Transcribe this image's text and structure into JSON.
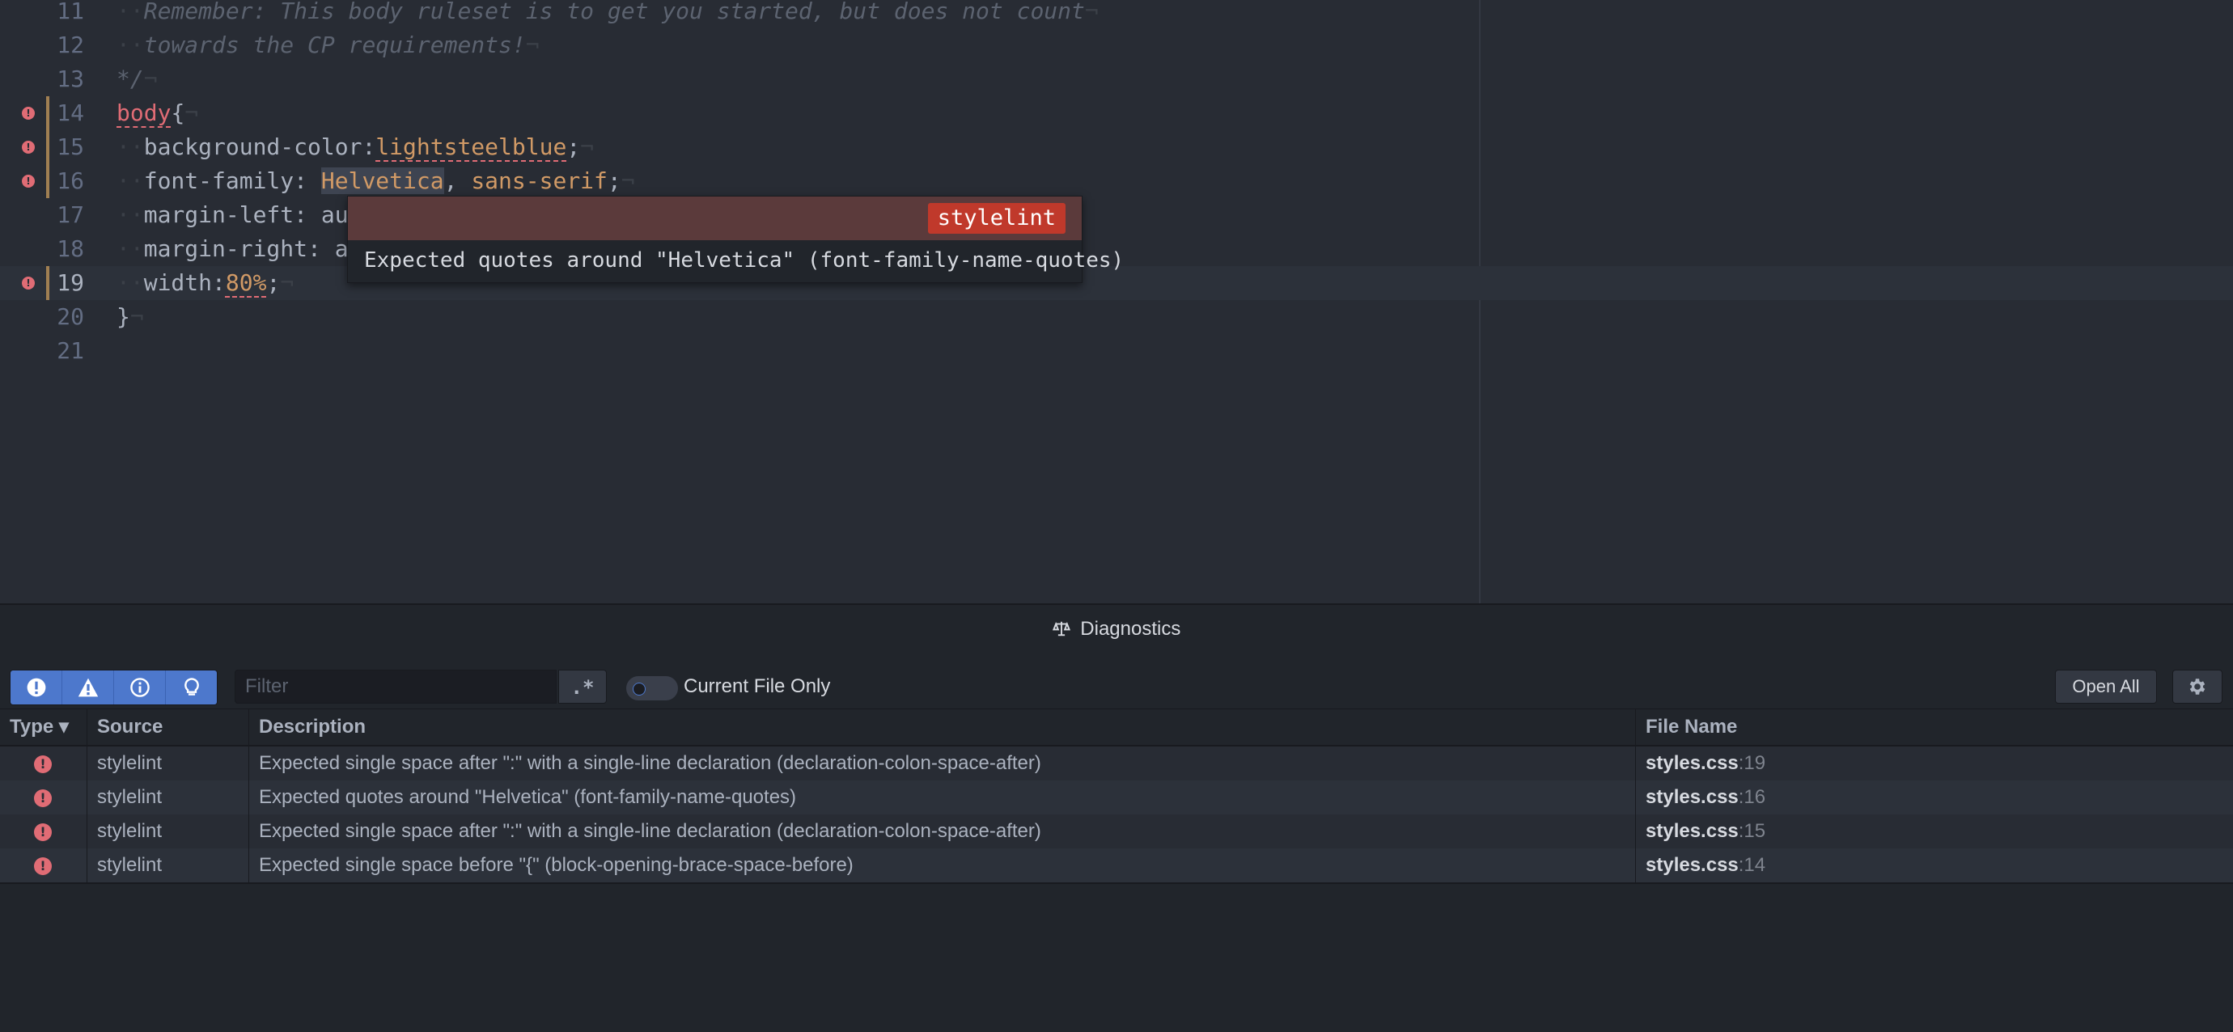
{
  "editor": {
    "lines": [
      {
        "num": "11",
        "segments": [
          {
            "t": "··",
            "c": "inv"
          },
          {
            "t": "Remember: This body ruleset is to get you started, but does not count",
            "c": "comment"
          },
          {
            "t": "¬",
            "c": "inv"
          }
        ]
      },
      {
        "num": "12",
        "segments": [
          {
            "t": "··",
            "c": "inv"
          },
          {
            "t": "towards the CP requirements!",
            "c": "comment"
          },
          {
            "t": "¬",
            "c": "inv"
          }
        ]
      },
      {
        "num": "13",
        "segments": [
          {
            "t": "*/",
            "c": "comment"
          },
          {
            "t": "¬",
            "c": "inv"
          }
        ]
      },
      {
        "num": "14",
        "error": true,
        "git": true,
        "segments": [
          {
            "t": "body",
            "c": "sel squig"
          },
          {
            "t": "{",
            "c": "prop"
          },
          {
            "t": "¬",
            "c": "inv"
          }
        ]
      },
      {
        "num": "15",
        "error": true,
        "git": true,
        "segments": [
          {
            "t": "··",
            "c": "inv"
          },
          {
            "t": "background-color:",
            "c": "prop"
          },
          {
            "t": "lightsteelblue",
            "c": "val squig"
          },
          {
            "t": ";",
            "c": "prop"
          },
          {
            "t": "¬",
            "c": "inv"
          }
        ]
      },
      {
        "num": "16",
        "error": true,
        "git": true,
        "segments": [
          {
            "t": "··",
            "c": "inv"
          },
          {
            "t": "font-family: ",
            "c": "prop"
          },
          {
            "t": "Helvetica",
            "c": "val sel-word"
          },
          {
            "t": ", ",
            "c": "prop"
          },
          {
            "t": "sans-serif",
            "c": "val"
          },
          {
            "t": ";",
            "c": "prop"
          },
          {
            "t": "¬",
            "c": "inv"
          }
        ]
      },
      {
        "num": "17",
        "segments": [
          {
            "t": "··",
            "c": "inv"
          },
          {
            "t": "margin-left: au",
            "c": "prop"
          }
        ]
      },
      {
        "num": "18",
        "segments": [
          {
            "t": "··",
            "c": "inv"
          },
          {
            "t": "margin-right: a",
            "c": "prop"
          }
        ]
      },
      {
        "num": "19",
        "error": true,
        "git": true,
        "cursor": true,
        "segments": [
          {
            "t": "··",
            "c": "inv"
          },
          {
            "t": "width:",
            "c": "prop"
          },
          {
            "t": "80%",
            "c": "num squig"
          },
          {
            "t": ";",
            "c": "prop"
          },
          {
            "t": "¬",
            "c": "inv"
          }
        ]
      },
      {
        "num": "20",
        "segments": [
          {
            "t": "}",
            "c": "prop"
          },
          {
            "t": "¬",
            "c": "inv"
          }
        ]
      },
      {
        "num": "21",
        "segments": []
      }
    ],
    "tooltip": {
      "badge": "stylelint",
      "message": "Expected quotes around \"Helvetica\" (font-family-name-quotes)"
    }
  },
  "panel": {
    "title": "Diagnostics",
    "title_icon": "diagnostics-scale-icon",
    "filter_buttons": [
      "error-icon",
      "warning-icon",
      "info-icon",
      "hint-icon"
    ],
    "filter_placeholder": "Filter",
    "regex_label": ".*",
    "toggle_label": "Current File Only",
    "open_all_label": "Open All",
    "settings_icon": "gear-icon",
    "columns": [
      "Type ▾",
      "Source",
      "Description",
      "File Name"
    ],
    "rows": [
      {
        "type": "error",
        "source": "stylelint",
        "description": "Expected single space after \":\" with a single-line declaration (declaration-colon-space-after)",
        "file": "styles.css",
        "line": ":19"
      },
      {
        "type": "error",
        "source": "stylelint",
        "description": "Expected quotes around \"Helvetica\" (font-family-name-quotes)",
        "file": "styles.css",
        "line": ":16"
      },
      {
        "type": "error",
        "source": "stylelint",
        "description": "Expected single space after \":\" with a single-line declaration (declaration-colon-space-after)",
        "file": "styles.css",
        "line": ":15"
      },
      {
        "type": "error",
        "source": "stylelint",
        "description": "Expected single space before \"{\" (block-opening-brace-space-before)",
        "file": "styles.css",
        "line": ":14"
      }
    ]
  },
  "colors": {
    "background": "#282c34",
    "accent": "#4d78cc",
    "error": "#e06c75",
    "badge": "#c0392b"
  }
}
